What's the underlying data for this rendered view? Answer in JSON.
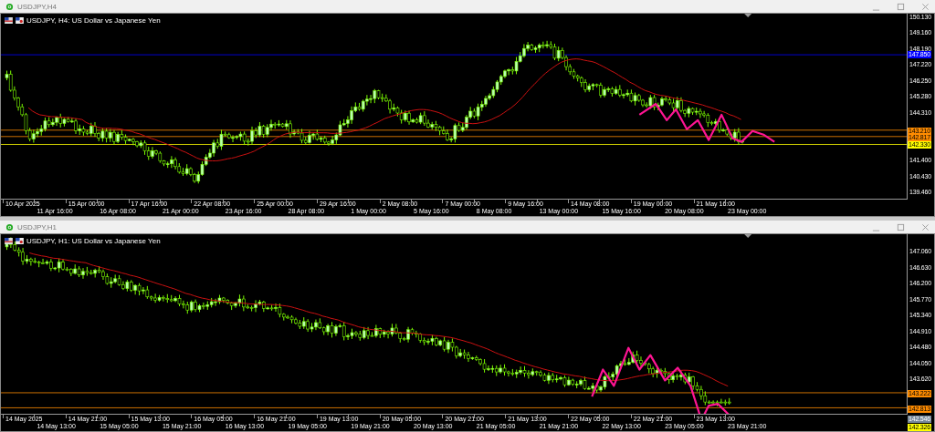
{
  "charts": [
    {
      "window_title": "USDJPY,H4",
      "legend": "USDJPY, H4:  US Dollar vs Japanese Yen",
      "price_ticks": [
        "150.130",
        "149.160",
        "148.190",
        "147.220",
        "146.250",
        "145.280",
        "144.310",
        "141.400",
        "140.430",
        "139.460"
      ],
      "price_labels": [
        {
          "text": "147.850",
          "color": "#0000ff"
        },
        {
          "text": "143.210",
          "color": "#ff8c00"
        },
        {
          "text": "142.817",
          "color": "#ff8c00"
        },
        {
          "text": "142.330",
          "color": "#ffff00"
        }
      ],
      "time_labels": [
        "10 Apr 2025",
        "11 Apr 16:00",
        "15 Apr 00:00",
        "16 Apr 08:00",
        "17 Apr 16:00",
        "21 Apr 00:00",
        "22 Apr 08:00",
        "23 Apr 16:00",
        "25 Apr 00:00",
        "28 Apr 08:00",
        "29 Apr 16:00",
        "1 May 00:00",
        "2 May 08:00",
        "5 May 16:00",
        "7 May 00:00",
        "8 May 08:00",
        "9 May 16:00",
        "13 May 00:00",
        "14 May 08:00",
        "15 May 16:00",
        "19 May 00:00",
        "20 May 08:00",
        "21 May 16:00",
        "23 May 00:00"
      ]
    },
    {
      "window_title": "USDJPY,H1",
      "legend": "USDJPY, H1:  US Dollar vs Japanese Yen",
      "price_ticks": [
        "147.060",
        "146.630",
        "146.200",
        "145.770",
        "145.340",
        "144.910",
        "144.480",
        "144.050",
        "143.620"
      ],
      "price_labels": [
        {
          "text": "143.222",
          "color": "#ff8c00"
        },
        {
          "text": "142.813",
          "color": "#ff8c00"
        },
        {
          "text": "142.546",
          "color": "#778899"
        },
        {
          "text": "142.326",
          "color": "#ffff00"
        }
      ],
      "time_labels": [
        "14 May 2025",
        "14 May 13:00",
        "14 May 21:00",
        "15 May 05:00",
        "15 May 13:00",
        "15 May 21:00",
        "16 May 05:00",
        "16 May 13:00",
        "16 May 21:00",
        "19 May 05:00",
        "19 May 13:00",
        "19 May 21:00",
        "20 May 05:00",
        "20 May 13:00",
        "20 May 21:00",
        "21 May 05:00",
        "21 May 13:00",
        "21 May 21:00",
        "22 May 05:00",
        "22 May 13:00",
        "22 May 21:00",
        "23 May 05:00",
        "23 May 13:00",
        "23 May 21:00"
      ]
    }
  ]
}
